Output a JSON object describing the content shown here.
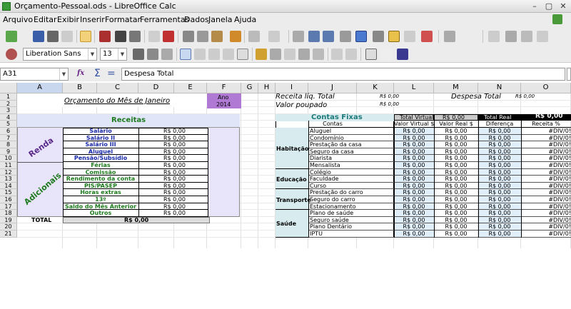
{
  "window": {
    "title": "Orçamento-Pessoal.ods - LibreOffice Calc"
  },
  "menu": [
    "Arquivo",
    "Editar",
    "Exibir",
    "Inserir",
    "Formatar",
    "Ferramentas",
    "Dados",
    "Janela",
    "Ajuda"
  ],
  "toolbar": {
    "font_name": "Liberation Sans",
    "font_size": "13"
  },
  "formula": {
    "cell_ref": "A31",
    "content": "Despesa Total",
    "fx_label": "fx",
    "sum_label": "Σ",
    "eq_label": "="
  },
  "columns": [
    "A",
    "B",
    "C",
    "D",
    "E",
    "F",
    "G",
    "H",
    "I",
    "J",
    "K",
    "L",
    "M",
    "N",
    "O"
  ],
  "rows": [
    "1",
    "2",
    "3",
    "4",
    "5",
    "6",
    "7",
    "8",
    "9",
    "10",
    "11",
    "12",
    "13",
    "14",
    "15",
    "16",
    "17",
    "18",
    "19",
    "20",
    "21"
  ],
  "sheet": {
    "orcamento_title": "Orçamento do Mês de Janeiro",
    "ano_label": "Ano",
    "ano_value": "2014",
    "receita_liq_label": "Receita líq. Total",
    "receita_liq_value": "R$ 0,00",
    "valor_poupado_label": "Valor poupado",
    "valor_poupado_value": "R$ 0,00",
    "despesa_total_label": "Despesa Total",
    "despesa_total_value": "R$ 0,00",
    "receitas_header": "Receitas",
    "renda_label": "Renda",
    "adicionais_label": "Adicionais",
    "receitas": [
      {
        "name": "Salário",
        "value": "R$ 0,00",
        "cls": "blue"
      },
      {
        "name": "Salário II",
        "value": "R$ 0,00",
        "cls": "blue"
      },
      {
        "name": "Salário III",
        "value": "R$ 0,00",
        "cls": "blue"
      },
      {
        "name": "Aluguel",
        "value": "R$ 0,00",
        "cls": "blue"
      },
      {
        "name": "Pensão/Subsídio",
        "value": "R$ 0,00",
        "cls": "blue"
      },
      {
        "name": "Férias",
        "value": "R$ 0,00",
        "cls": "green"
      },
      {
        "name": "Comissão",
        "value": "R$ 0,00",
        "cls": "green"
      },
      {
        "name": "Rendimento da conta",
        "value": "R$ 0,00",
        "cls": "green"
      },
      {
        "name": "PIS/PASEP",
        "value": "R$ 0,00",
        "cls": "green"
      },
      {
        "name": "Horas extras",
        "value": "R$ 0,00",
        "cls": "green"
      },
      {
        "name": "13º",
        "value": "R$ 0,00",
        "cls": "green"
      },
      {
        "name": "Saldo do Mês Anterior",
        "value": "R$ 0,00",
        "cls": "green"
      },
      {
        "name": "Outros",
        "value": "R$ 0,00",
        "cls": "green"
      }
    ],
    "total_label": "TOTAL",
    "total_value": "R$ 0,00",
    "contas_fixas_header": "Contas Fixas",
    "total_virtual_label": "Total Virtual",
    "total_virtual_value": "R$ 0,00",
    "total_real_label": "Total Real",
    "total_real_value": "R$ 0,00",
    "col_headers": [
      "Contas",
      "Valor Virtual $",
      "Valor Real $",
      "Diferença",
      "Receita %"
    ],
    "groups": [
      {
        "name": "Habitação",
        "items": [
          "Aluguel",
          "Condomínio",
          "Prestação da casa",
          "Seguro da casa",
          "Diarista",
          "Mensalista"
        ]
      },
      {
        "name": "Educação",
        "items": [
          "Colégio",
          "Faculdade",
          "Curso"
        ]
      },
      {
        "name": "Transporte",
        "items": [
          "Prestação do carro",
          "Seguro do carro",
          "Estacionamento"
        ]
      },
      {
        "name": "Saúde",
        "items": [
          "Plano de saúde",
          "Seguro saúde",
          "Plano Dentário",
          "IPTU"
        ]
      }
    ],
    "row_values": {
      "virtual": "R$ 0,00",
      "real": "R$ 0,00",
      "diff": "R$ 0,00",
      "pct": "#DIV/0!"
    }
  }
}
